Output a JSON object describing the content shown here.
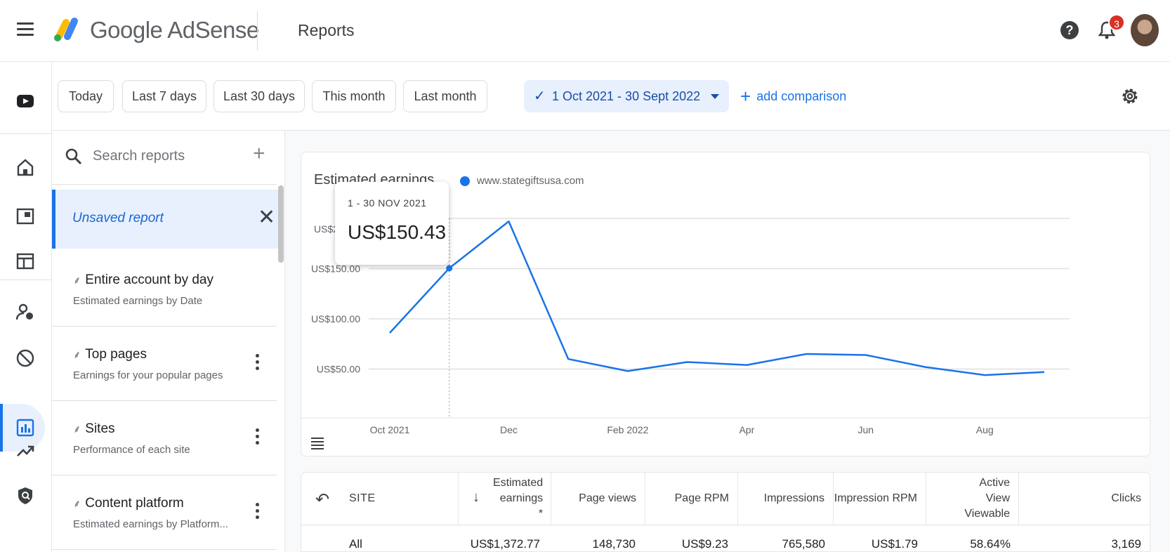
{
  "app": {
    "brand": "Google AdSense",
    "page_title": "Reports",
    "notification_count": "3"
  },
  "filters": {
    "chips": [
      "Today",
      "Last 7 days",
      "Last 30 days",
      "This month",
      "Last month"
    ],
    "date_range": "1 Oct 2021 - 30 Sept 2022",
    "add_comparison": "add comparison"
  },
  "reports_panel": {
    "search_placeholder": "Search reports",
    "unsaved_report": "Unsaved report",
    "items": [
      {
        "title": "Entire account by day",
        "subtitle": "Estimated earnings by Date"
      },
      {
        "title": "Top pages",
        "subtitle": "Earnings for your popular pages"
      },
      {
        "title": "Sites",
        "subtitle": "Performance of each site"
      },
      {
        "title": "Content platform",
        "subtitle": "Estimated earnings by Platform..."
      }
    ]
  },
  "chart": {
    "title": "Estimated earnings",
    "legend": "www.stategiftsusa.com",
    "tooltip": {
      "date": "1 - 30 NOV 2021",
      "value": "US$150.43"
    }
  },
  "chart_data": {
    "type": "line",
    "title": "Estimated earnings",
    "x": [
      "Oct 2021",
      "Nov 2021",
      "Dec 2021",
      "Jan 2022",
      "Feb 2022",
      "Mar 2022",
      "Apr 2022",
      "May 2022",
      "Jun 2022",
      "Jul 2022",
      "Aug 2022",
      "Sep 2022"
    ],
    "series": [
      {
        "name": "www.stategiftsusa.com",
        "values": [
          86,
          150.43,
          197,
          60,
          48,
          57,
          54,
          65,
          64,
          52,
          44,
          47
        ]
      }
    ],
    "x_tick_labels": [
      "Oct 2021",
      "Dec",
      "Feb 2022",
      "Apr",
      "Jun",
      "Aug"
    ],
    "y_tick_labels": [
      "US$50.00",
      "US$100.00",
      "US$150.00",
      "US$2"
    ],
    "ylim": [
      0,
      200
    ],
    "grid": true,
    "color": "#1a73e8"
  },
  "table": {
    "columns": [
      "SITE",
      "Estimated earnings *",
      "Page views",
      "Page RPM",
      "Impressions",
      "Impression RPM",
      "Active View Viewable",
      "Clicks"
    ],
    "row": [
      "All",
      "US$1,372.77",
      "148,730",
      "US$9.23",
      "765,580",
      "US$1.79",
      "58.64%",
      "3,169"
    ]
  }
}
